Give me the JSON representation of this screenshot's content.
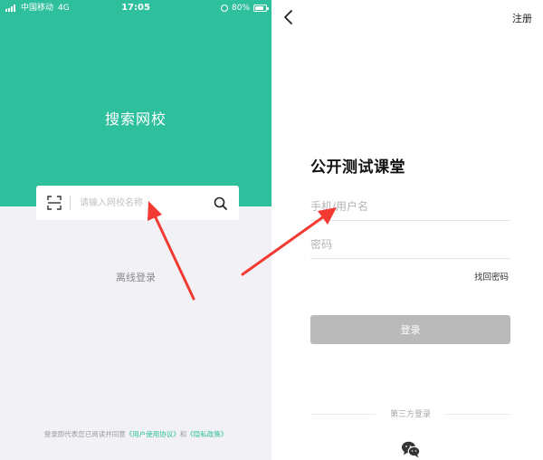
{
  "left": {
    "status_bar": {
      "carrier": "中国移动",
      "network": "4G",
      "time": "17:05",
      "battery": "80%"
    },
    "title": "搜索网校",
    "search": {
      "placeholder": "请输入网校名称"
    },
    "offline_login": "离线登录",
    "agreement": {
      "prefix": "登录即代表您已阅读并同意",
      "terms": "《用户使用协议》",
      "and": "和",
      "privacy": "《隐私政策》"
    }
  },
  "right": {
    "register": "注册",
    "school_name": "公开测试课堂",
    "username_placeholder": "手机/用户名",
    "password_placeholder": "密码",
    "forgot_password": "找回密码",
    "login_button": "登录",
    "third_party_label": "第三方登录"
  },
  "colors": {
    "brand": "#2ebf9c",
    "annotation": "#f23a33",
    "disabled_button": "#bababa"
  },
  "icons": [
    "signal-icon",
    "alarm-icon",
    "battery-icon",
    "scan-icon",
    "search-icon",
    "back-icon",
    "wechat-icon"
  ]
}
